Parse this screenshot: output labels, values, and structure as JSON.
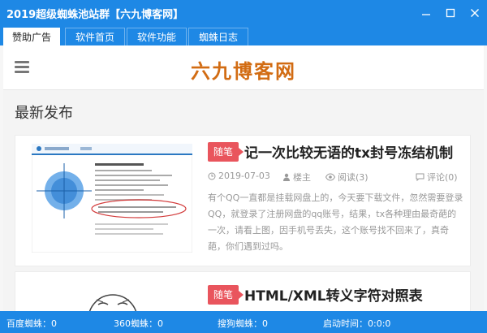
{
  "window": {
    "title": "2019超级蜘蛛池站群【六九博客网】"
  },
  "tabs": [
    {
      "label": "赞助广告",
      "active": true
    },
    {
      "label": "软件首页",
      "active": false
    },
    {
      "label": "软件功能",
      "active": false
    },
    {
      "label": "蜘蛛日志",
      "active": false
    }
  ],
  "site": {
    "logo": "六九博客网",
    "section_title": "最新发布"
  },
  "posts": [
    {
      "badge": "随笔",
      "title": "记一次比较无语的tx封号冻结机制",
      "date": "2019-07-03",
      "author": "楼主",
      "views": "阅读(3)",
      "comments": "评论(0)",
      "excerpt": "有个QQ一直都是挂载网盘上的，今天要下载文件，忽然需要登录QQ，就登录了注册网盘的qq账号，结果，tx各种理由最奇葩的一次，请看上图，因手机号丢失，这个账号找不回来了，真奇葩，你们遇到过吗。"
    },
    {
      "badge": "随笔",
      "title": "HTML/XML转义字符对照表"
    }
  ],
  "statusbar": {
    "baidu": "百度蜘蛛：0",
    "s360": "360蜘蛛：0",
    "sogou": "搜狗蜘蛛：0",
    "runtime": "启动时间：0:0:0"
  },
  "colors": {
    "primary": "#1e88e5",
    "badge": "#e9555d",
    "logo": "#d26c13"
  },
  "icons": [
    "minimize-icon",
    "maximize-icon",
    "close-icon",
    "menu-icon",
    "clock-icon",
    "user-icon",
    "eye-icon",
    "comment-icon"
  ]
}
